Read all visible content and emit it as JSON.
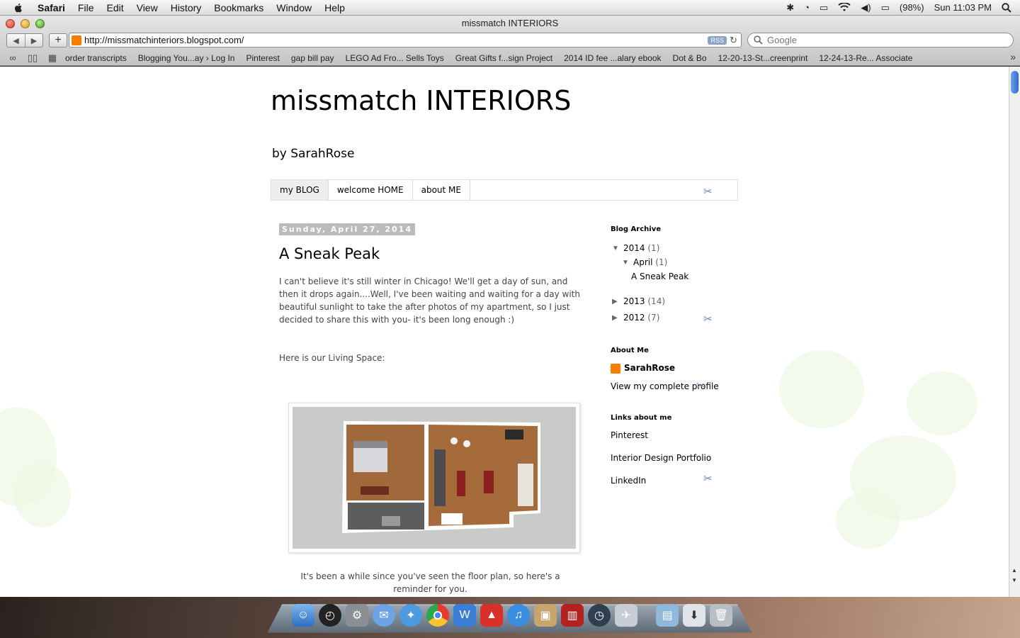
{
  "menubar": {
    "app": "Safari",
    "menus": [
      "File",
      "Edit",
      "View",
      "History",
      "Bookmarks",
      "Window",
      "Help"
    ],
    "battery": "(98%)",
    "clock": "Sun 11:03 PM"
  },
  "window": {
    "title": "missmatch INTERIORS",
    "url": "http://missmatchinteriors.blogspot.com/",
    "rss_label": "RSS",
    "search_placeholder": "Google"
  },
  "bookmarks": [
    "order transcripts",
    "Blogging You...ay › Log In",
    "Pinterest",
    "gap bill pay",
    "LEGO Ad Fro... Sells Toys",
    "Great Gifts f...sign Project",
    "2014 ID fee ...alary ebook",
    "Dot & Bo",
    "12-20-13-St...creenprint",
    "12-24-13-Re... Associate"
  ],
  "blog": {
    "title": "missmatch INTERIORS",
    "description": "by SarahRose",
    "tabs": [
      "my BLOG",
      "welcome HOME",
      "about ME"
    ]
  },
  "post": {
    "date": "Sunday, April 27, 2014",
    "title": "A Sneak Peak",
    "body1": "I can't believe it's still winter in Chicago!  We'll get a day of sun, and then it drops again....Well, I've been waiting and waiting for a day with beautiful sunlight to take the after photos of my apartment, so I just decided to share this with you- it's been long enough :)",
    "body2": "Here is our Living Space:",
    "caption": "It's been a while since you've seen the floor plan, so here's a reminder for you."
  },
  "sidebar": {
    "archive_heading": "Blog Archive",
    "archive": [
      {
        "year": "2014",
        "count": "(1)"
      },
      {
        "month": "April",
        "count": "(1)"
      },
      {
        "post": "A Sneak Peak"
      },
      {
        "year": "2013",
        "count": "(14)"
      },
      {
        "year": "2012",
        "count": "(7)"
      }
    ],
    "about_heading": "About Me",
    "author": "SarahRose",
    "profile_link": "View my complete profile",
    "links_heading": "Links about me",
    "links": [
      "Pinterest",
      "Interior Design Portfolio",
      "LinkedIn"
    ]
  },
  "dock_icons": [
    "finder-icon",
    "dashboard-icon",
    "system-preferences-icon",
    "ichat-icon",
    "safari-icon",
    "chrome-icon",
    "iwork-icon",
    "sketchup-icon",
    "itunes-icon",
    "iphoto-icon",
    "photo-booth-icon",
    "time-machine-icon",
    "preview-icon",
    "documents-folder-icon",
    "downloads-icon",
    "trash-icon"
  ]
}
